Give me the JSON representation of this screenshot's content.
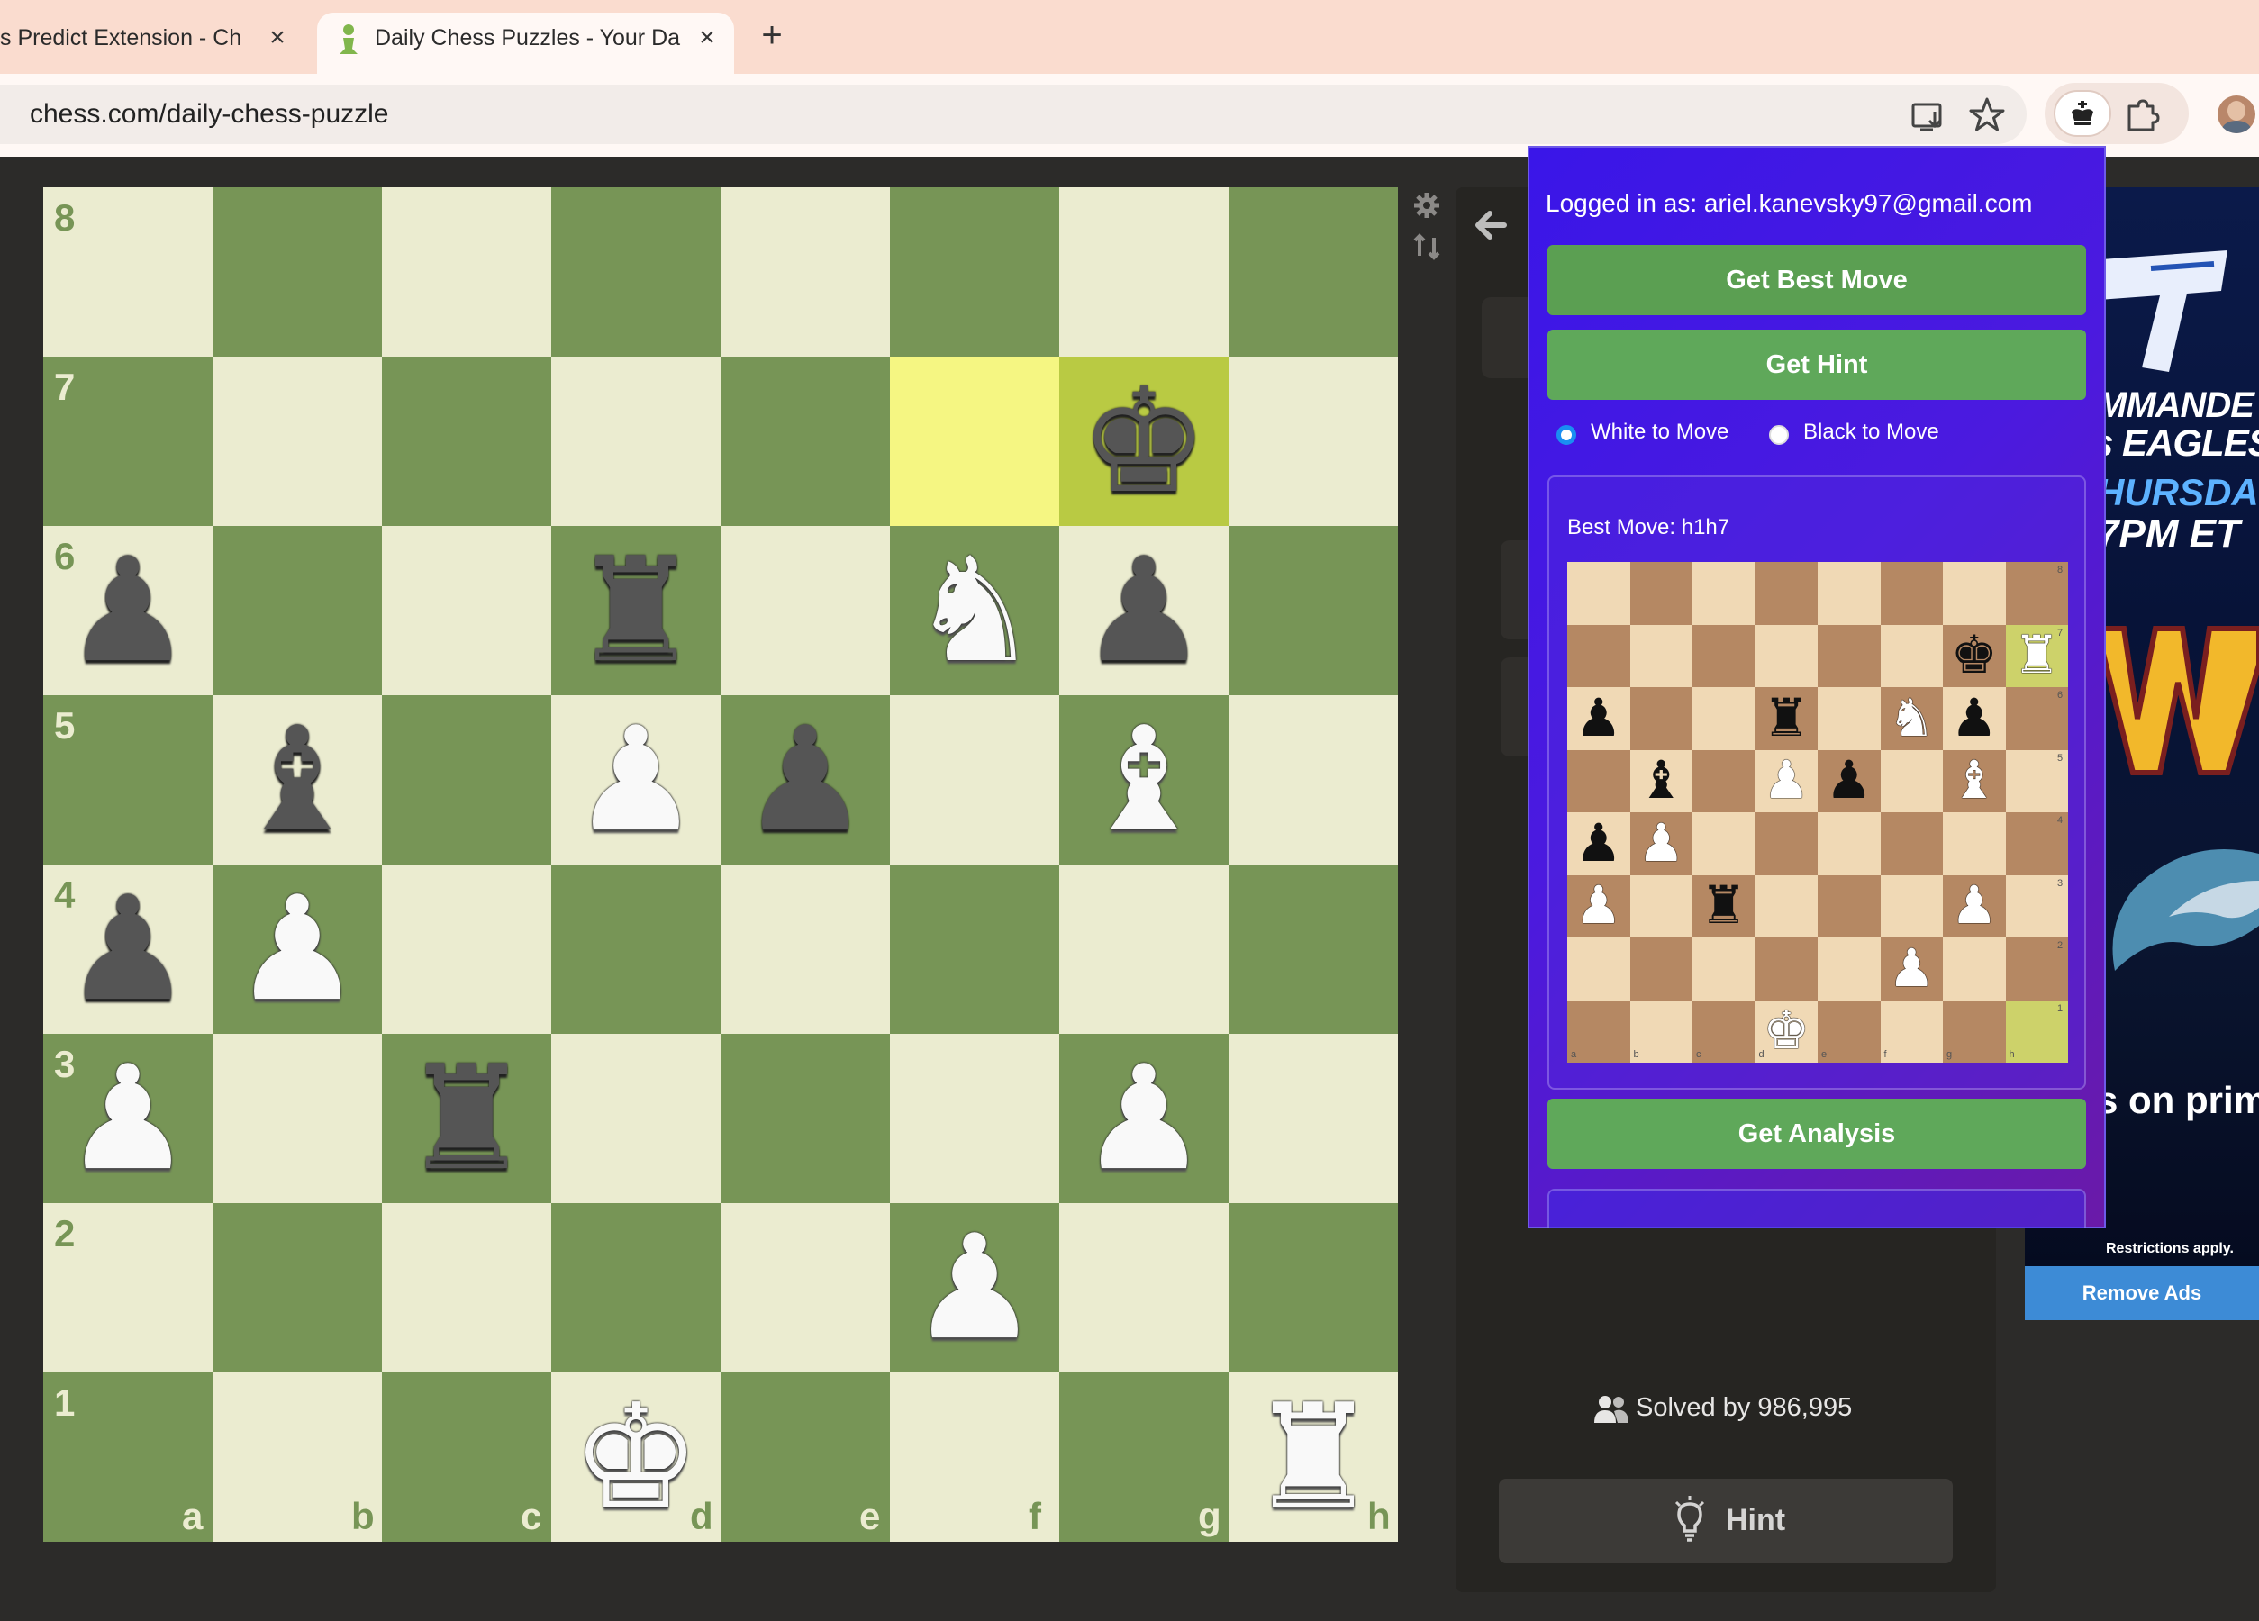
{
  "browser": {
    "tabs": [
      {
        "title": "s Predict Extension - Ch",
        "close": "×"
      },
      {
        "title": "Daily Chess Puzzles - Your Da",
        "close": "×"
      }
    ],
    "new_tab": "+",
    "url": "chess.com/daily-chess-puzzle"
  },
  "board": {
    "ranks": [
      "8",
      "7",
      "6",
      "5",
      "4",
      "3",
      "2",
      "1"
    ],
    "files": [
      "a",
      "b",
      "c",
      "d",
      "e",
      "f",
      "g",
      "h"
    ],
    "highlight": [
      "f7",
      "g7"
    ],
    "pieces": [
      {
        "square": "g7",
        "type": "king",
        "color": "black",
        "glyph": "♚"
      },
      {
        "square": "a6",
        "type": "pawn",
        "color": "black",
        "glyph": "♟"
      },
      {
        "square": "d6",
        "type": "rook",
        "color": "black",
        "glyph": "♜"
      },
      {
        "square": "f6",
        "type": "knight",
        "color": "white",
        "glyph": "♞"
      },
      {
        "square": "g6",
        "type": "pawn",
        "color": "black",
        "glyph": "♟"
      },
      {
        "square": "b5",
        "type": "bishop",
        "color": "black",
        "glyph": "♝"
      },
      {
        "square": "d5",
        "type": "pawn",
        "color": "white",
        "glyph": "♟"
      },
      {
        "square": "e5",
        "type": "pawn",
        "color": "black",
        "glyph": "♟"
      },
      {
        "square": "g5",
        "type": "bishop",
        "color": "white",
        "glyph": "♝"
      },
      {
        "square": "a4",
        "type": "pawn",
        "color": "black",
        "glyph": "♟"
      },
      {
        "square": "b4",
        "type": "pawn",
        "color": "white",
        "glyph": "♟"
      },
      {
        "square": "a3",
        "type": "pawn",
        "color": "white",
        "glyph": "♟"
      },
      {
        "square": "c3",
        "type": "rook",
        "color": "black",
        "glyph": "♜"
      },
      {
        "square": "g3",
        "type": "pawn",
        "color": "white",
        "glyph": "♟"
      },
      {
        "square": "f2",
        "type": "pawn",
        "color": "white",
        "glyph": "♟"
      },
      {
        "square": "d1",
        "type": "king",
        "color": "white",
        "glyph": "♚"
      },
      {
        "square": "h1",
        "type": "rook",
        "color": "white",
        "glyph": "♜"
      }
    ]
  },
  "panel": {
    "solved_text": "Solved by 986,995",
    "hint_label": "Hint"
  },
  "ad": {
    "line1": "MMANDE",
    "line2": "s EAGLES",
    "line3": "HURSDAY",
    "line4": "7PM ET",
    "prime_text": "s on prime",
    "restrictions": "Restrictions apply.",
    "remove_ads": "Remove Ads"
  },
  "popup": {
    "logged_in": "Logged in as: ariel.kanevsky97@gmail.com",
    "get_best_move": "Get Best Move",
    "get_hint": "Get Hint",
    "white_to_move": "White to Move",
    "black_to_move": "Black to Move",
    "selected_side": "white",
    "best_move_label": "Best Move: h1h7",
    "get_analysis": "Get Analysis",
    "mini_board": {
      "highlight": [
        "h7",
        "h1"
      ],
      "pieces": [
        {
          "square": "g7",
          "color": "black",
          "glyph": "♚"
        },
        {
          "square": "h7",
          "color": "white",
          "glyph": "♜"
        },
        {
          "square": "a6",
          "color": "black",
          "glyph": "♟"
        },
        {
          "square": "d6",
          "color": "black",
          "glyph": "♜"
        },
        {
          "square": "f6",
          "color": "white",
          "glyph": "♞"
        },
        {
          "square": "g6",
          "color": "black",
          "glyph": "♟"
        },
        {
          "square": "b5",
          "color": "black",
          "glyph": "♝"
        },
        {
          "square": "d5",
          "color": "white",
          "glyph": "♟"
        },
        {
          "square": "e5",
          "color": "black",
          "glyph": "♟"
        },
        {
          "square": "g5",
          "color": "white",
          "glyph": "♝"
        },
        {
          "square": "a4",
          "color": "black",
          "glyph": "♟"
        },
        {
          "square": "b4",
          "color": "white",
          "glyph": "♟"
        },
        {
          "square": "a3",
          "color": "white",
          "glyph": "♟"
        },
        {
          "square": "c3",
          "color": "black",
          "glyph": "♜"
        },
        {
          "square": "g3",
          "color": "white",
          "glyph": "♟"
        },
        {
          "square": "f2",
          "color": "white",
          "glyph": "♟"
        },
        {
          "square": "d1",
          "color": "white",
          "glyph": "♚"
        }
      ]
    }
  },
  "colors": {
    "board_light": "#ebecd0",
    "board_dark": "#779556",
    "highlight": "#f5f682",
    "popup_button": "#5fa85a",
    "popup_bg": "#3a16e8"
  }
}
